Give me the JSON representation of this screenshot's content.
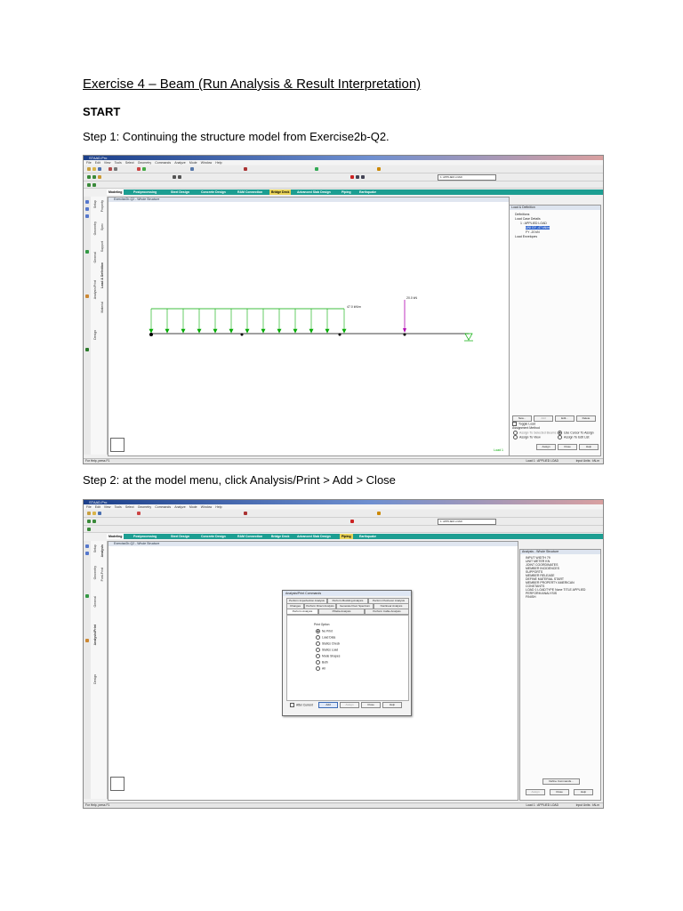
{
  "document": {
    "title": "Exercise 4 – Beam (Run Analysis & Result Interpretation)",
    "start_heading": "START",
    "step1_text": "Step 1: Continuing the structure model from Exercise2b-Q2.",
    "step2_text": "Step 2: at the model menu, click Analysis/Print > Add > Close"
  },
  "app": {
    "window_title": "STAAD.Pro",
    "menu_items": [
      "File",
      "Edit",
      "View",
      "Tools",
      "Select",
      "Geometry",
      "Commands",
      "Analyze",
      "Mode",
      "Window",
      "Help"
    ],
    "load_select_value": "1: APPLIED LOAD",
    "tabs": [
      "Modeling",
      "Postprocessing",
      "Steel Design",
      "Concrete Design",
      "RAM Connection",
      "Bridge Deck",
      "Advanced Slab Design",
      "Piping",
      "Earthquake"
    ],
    "status_help": "For Help, press F1",
    "status_load": "Load 1 : APPLIED LOAD",
    "status_units": "Input Units : kN-m"
  },
  "shot1": {
    "viewport_title": "Exercise2b-Q2 - Whole Structure",
    "side_tabs": [
      "Setup",
      "Geometry",
      "General",
      "Analysis/Print",
      "Design"
    ],
    "sub_tabs": [
      "Property",
      "Spec",
      "Support",
      "Load & Definition",
      "Material"
    ],
    "udl_label": "47.0 kN/m",
    "point_load_label": "20.0 kN",
    "viewport_footer": "Load 1",
    "panel_title": "Load & Definition",
    "tree": [
      "Definitions",
      "Load Case Details",
      "1 : APPLIED LOAD",
      "UNI GY -47 kN/m",
      "FY -20 kN",
      "Load Envelopes"
    ],
    "buttons": [
      "New...",
      "Add",
      "Edit...",
      "Delete"
    ],
    "toggle_load": "Toggle Load",
    "assign_method_label": "Assignment Method",
    "assign_options": [
      "Assign To Selected Beams",
      "Use Cursor To Assign",
      "Assign To View",
      "Assign To Edit List"
    ],
    "assign_buttons": [
      "Assign",
      "Close",
      "Help"
    ]
  },
  "shot2": {
    "viewport_title": "Exercise2b-Q2 - Whole Structure",
    "side_tabs": [
      "Setup",
      "Geometry",
      "General",
      "Analysis/Print",
      "Design"
    ],
    "sub_tabs": [
      "Analysis",
      "Post-Print"
    ],
    "panel_title": "Analysis - Whole Structure",
    "tree": [
      "INPUT WIDTH 79",
      "UNIT METER KN",
      "JOINT COORDINATES",
      "MEMBER INCIDENCES",
      "SUPPORTS",
      "MEMBER RELEASE",
      "DEFINE MATERIAL START",
      "MEMBER PROPERTY AMERICAN",
      "CONSTANTS",
      "LOAD 1 LOADTYPE None TITLE APPLIED",
      "PERFORM ANALYSIS",
      "FINISH"
    ],
    "panel_buttons": [
      "Define Commands...",
      "Assign",
      "Close",
      "Help"
    ],
    "dialog": {
      "title": "Analysis/Print Commands",
      "tabs_row1": [
        "Perform Imperfection Analysis",
        "Perform Buckling Analysis",
        "Perform Pushover Analysis"
      ],
      "tabs_row2": [
        "Changes",
        "Perform Direct Analysis",
        "Generate Floor Spectrum",
        "Nonlinear Analysis"
      ],
      "tabs_row3": [
        "Perform Analysis",
        "PDelta Analysis",
        "Perform Cable Analysis"
      ],
      "group_label": "Print Option",
      "options": [
        "No Print",
        "Load Data",
        "Statics Check",
        "Statics Load",
        "Mode Shapes",
        "Both",
        "All"
      ],
      "selected_option": "No Print",
      "after_current": "After Current",
      "buttons": [
        "Add",
        "Assign",
        "Close",
        "Help"
      ]
    }
  }
}
